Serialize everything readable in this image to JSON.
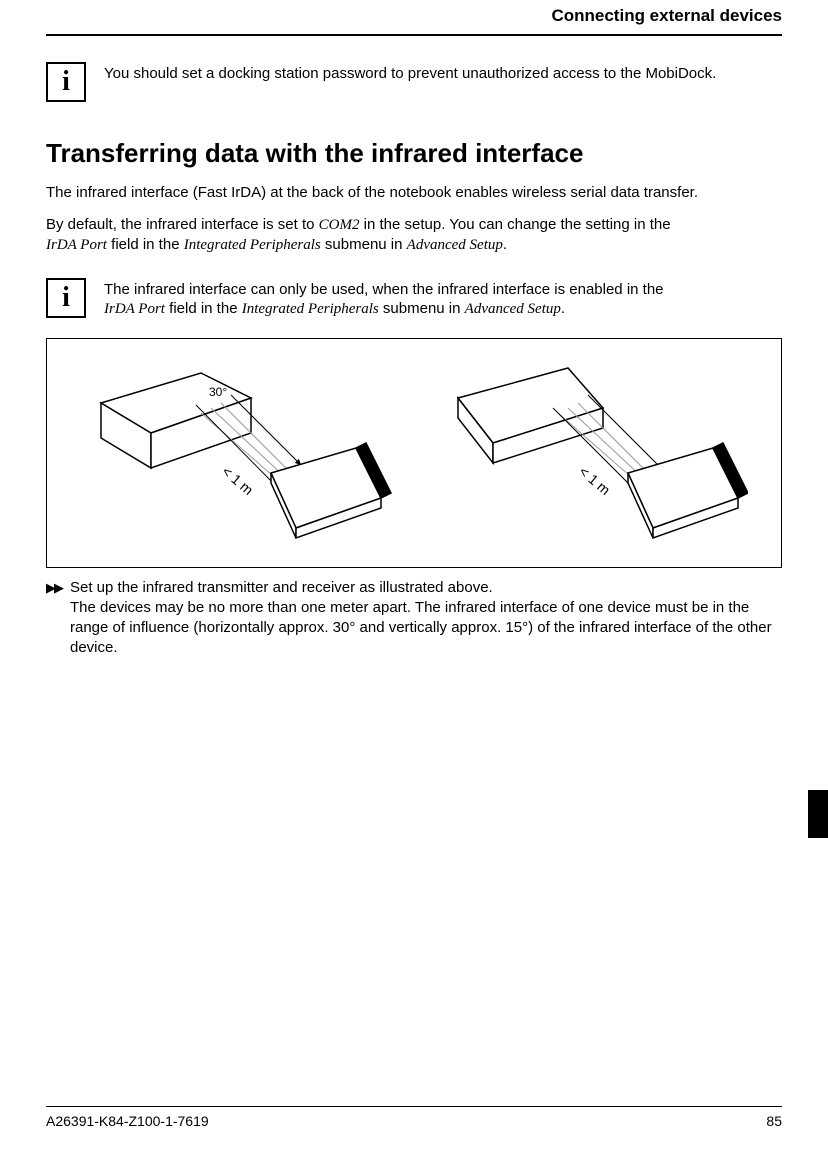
{
  "header": {
    "title": "Connecting external devices"
  },
  "info1": {
    "icon": "i",
    "text": "You should set a docking station password to prevent unauthorized access to the MobiDock."
  },
  "section": {
    "heading": "Transferring data with the infrared interface"
  },
  "para1": "The infrared interface (Fast IrDA) at the back of the notebook enables wireless serial data transfer.",
  "para2": {
    "a": "By default, the infrared interface is set to ",
    "com": "COM2",
    "b": " in the setup. You can change the setting in the ",
    "irda": "IrDA Port",
    "c": " field in the ",
    "ip": "Integrated Peripherals",
    "d": " submenu in ",
    "as": "Advanced Setup",
    "e": "."
  },
  "info2": {
    "icon": "i",
    "a": "The infrared interface can only be used, when the infrared interface is enabled in the ",
    "irda": "IrDA Port",
    "b": " field in the ",
    "ip": "Integrated Peripherals",
    "c": " submenu in ",
    "as": "Advanced Setup",
    "d": "."
  },
  "figure": {
    "angle": "30°",
    "dist": "< 1 m"
  },
  "step": {
    "marker": "▶▶",
    "text": "Set up the infrared transmitter and receiver as illustrated above.\nThe devices may be no more than one meter apart. The infrared interface of one device must be in the range of influence (horizontally approx. 30° and vertically approx. 15°) of the infrared interface of the other device."
  },
  "footer": {
    "docid": "A26391-K84-Z100-1-7619",
    "page": "85"
  }
}
